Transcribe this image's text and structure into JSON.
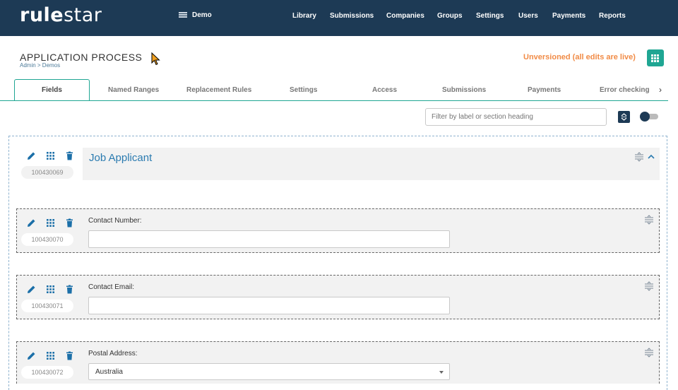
{
  "topbar": {
    "logo_bold": "rule",
    "logo_light": "star",
    "workspace": "Demo",
    "nav": [
      "Library",
      "Submissions",
      "Companies",
      "Groups",
      "Settings",
      "Users",
      "Payments",
      "Reports"
    ]
  },
  "header": {
    "title": "APPLICATION PROCESS",
    "breadcrumb": "Admin > Demos",
    "status": "Unversioned (all edits are live)"
  },
  "tabs": [
    "Fields",
    "Named Ranges",
    "Replacement Rules",
    "Settings",
    "Access",
    "Submissions",
    "Payments",
    "Error checking"
  ],
  "active_tab": "Fields",
  "filter": {
    "placeholder": "Filter by label or section heading",
    "value": ""
  },
  "section": {
    "id": "100430069",
    "title": "Job Applicant"
  },
  "fields": [
    {
      "id": "100430070",
      "label": "Contact Number:",
      "value": "",
      "type": "text"
    },
    {
      "id": "100430071",
      "label": "Contact Email:",
      "value": "",
      "type": "text"
    },
    {
      "id": "100430072",
      "label": "Postal Address:",
      "value": "Australia",
      "type": "select"
    }
  ],
  "colors": {
    "navy": "#1d3a55",
    "teal": "#1fa693",
    "orange": "#f18b46",
    "blue": "#2b7bb0"
  },
  "icons": {
    "edit": "pencil-icon",
    "move": "grid-drag-icon",
    "delete": "trash-icon",
    "reorder": "reorder-icon",
    "collapse": "chevron-up-icon",
    "sort": "sort-arrows-icon",
    "menu": "grid-menu-icon",
    "workspace": "server-icon"
  }
}
